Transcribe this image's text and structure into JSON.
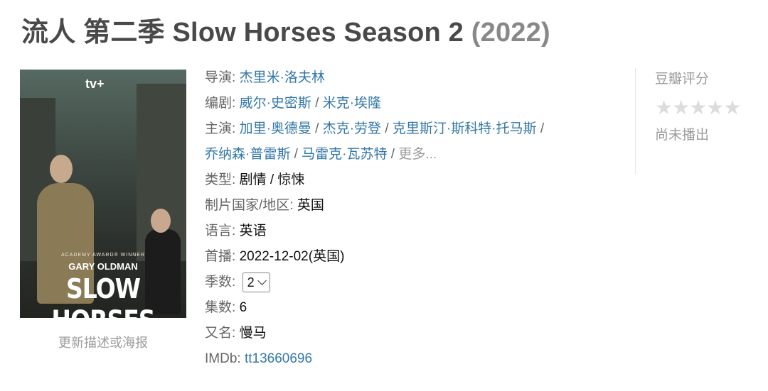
{
  "header": {
    "title_main": "流人 第二季 Slow Horses Season 2",
    "year": "(2022)"
  },
  "poster": {
    "brand": "tv+",
    "academy": "ACADEMY AWARD® WINNER",
    "actor": "GARY OLDMAN",
    "show": "SLOW HORSES",
    "update_link": "更新描述或海报"
  },
  "info": {
    "director_label": "导演:",
    "directors": [
      "杰里米·洛夫林"
    ],
    "writer_label": "编剧:",
    "writers": [
      "威尔·史密斯",
      "米克·埃隆"
    ],
    "cast_label": "主演:",
    "cast": [
      "加里·奥德曼",
      "杰克·劳登",
      "克里斯汀·斯科特·托马斯",
      "乔纳森·普雷斯",
      "马雷克·瓦苏特"
    ],
    "cast_more": "更多...",
    "separator": "/",
    "genre_label": "类型:",
    "genres": [
      "剧情",
      "惊悚"
    ],
    "country_label": "制片国家/地区:",
    "country": "英国",
    "language_label": "语言:",
    "language": "英语",
    "premiere_label": "首播:",
    "premiere": "2022-12-02(英国)",
    "season_label": "季数:",
    "season_selected": "2",
    "episodes_label": "集数:",
    "episodes": "6",
    "aka_label": "又名:",
    "aka": "慢马",
    "imdb_label": "IMDb:",
    "imdb": "tt13660696"
  },
  "rating": {
    "label": "豆瓣评分",
    "stars": "★★★★★",
    "status": "尚未播出"
  },
  "colors": {
    "link": "#3377aa",
    "title": "#494949",
    "muted": "#9b9b9b"
  }
}
